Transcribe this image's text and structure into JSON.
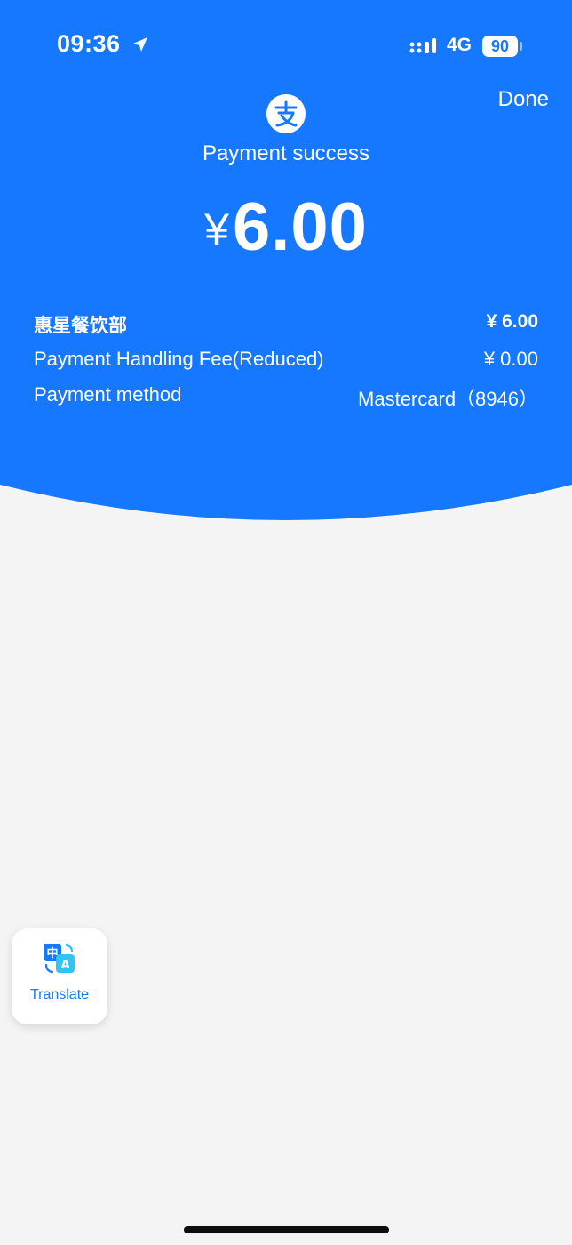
{
  "status_bar": {
    "time": "09:36",
    "network": "4G",
    "battery": "90"
  },
  "header": {
    "done_label": "Done",
    "title": "Payment success",
    "currency_symbol": "¥",
    "amount": "6.00"
  },
  "details": [
    {
      "label": "惠星餐饮部",
      "value": "¥ 6.00"
    },
    {
      "label": "Payment Handling Fee(Reduced)",
      "value": "¥ 0.00"
    },
    {
      "label": "Payment method",
      "value": "Mastercard（8946）"
    }
  ],
  "translate": {
    "label": "Translate",
    "icon_char_zh": "中",
    "icon_char_en": "A"
  },
  "colors": {
    "accent": "#1677ff",
    "background": "#f4f4f4"
  }
}
